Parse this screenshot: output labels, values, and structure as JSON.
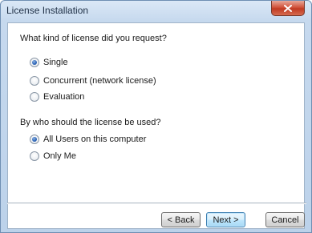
{
  "window": {
    "title": "License Installation",
    "close_glyph": "×"
  },
  "license_question": {
    "text": "What kind of license did you request?",
    "options": [
      {
        "label": "Single",
        "selected": true
      },
      {
        "label": "Concurrent (network license)",
        "selected": false
      },
      {
        "label": "Evaluation",
        "selected": false
      }
    ]
  },
  "usage_question": {
    "text": "By who should the license be used?",
    "options": [
      {
        "label": "All Users on this computer",
        "selected": true
      },
      {
        "label": "Only Me",
        "selected": false
      }
    ]
  },
  "buttons": {
    "back": "< Back",
    "next": "Next >",
    "cancel": "Cancel"
  },
  "colors": {
    "close_button": "#c94a2f",
    "default_button_border": "#3c7fb1",
    "radio_selected": "#2a62b6"
  }
}
